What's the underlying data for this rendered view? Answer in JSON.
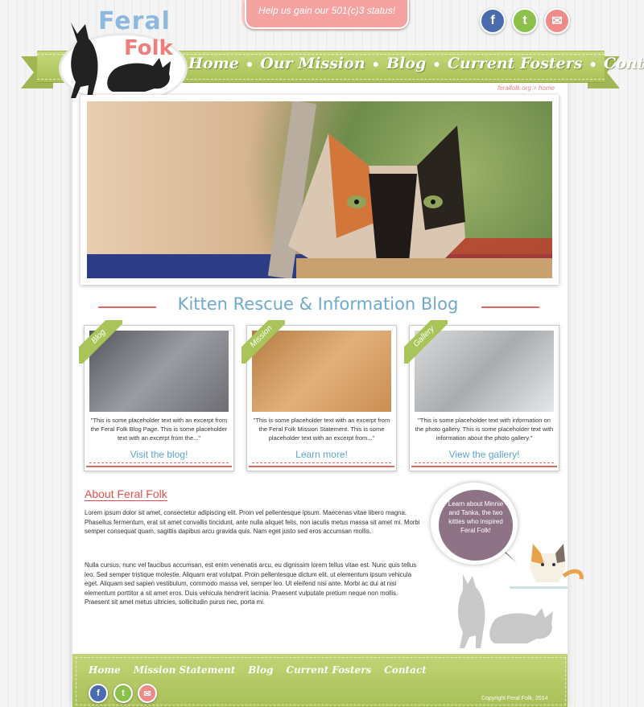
{
  "banner": {
    "text": "Help us gain our 501(c)3 status!"
  },
  "logo": {
    "word1": "Feral",
    "word2": "Folk"
  },
  "nav": {
    "items": [
      "Home",
      "Our Mission",
      "Blog",
      "Current Fosters",
      "Contact"
    ]
  },
  "social": {
    "facebook": "f",
    "twitter": "t",
    "mail": "✉"
  },
  "breadcrumb": "feralfolk.org > home",
  "section_title": "Kitten Rescue & Information Blog",
  "cards": [
    {
      "tag": "Blog",
      "text": "\"This is some placeholder text with an excerpt from the Feral Folk Blog Page. This is some placeholder text with an excerpt from the...\"",
      "link": "Visit the blog!",
      "color": "#7e7f86"
    },
    {
      "tag": "Mission",
      "text": "\"This is some placeholder text with an excerpt from the Feral Folk Mission Statement. This is some placeholder text with an excerpt from...\"",
      "link": "Learn more!",
      "color": "#d99a5e"
    },
    {
      "tag": "Gallery",
      "text": "\"This is some placeholder text with information on the photo gallery. This is some placeholder text with information about the photo gallery.\"",
      "link": "View the gallery!",
      "color": "#b9bdc1"
    }
  ],
  "about": {
    "heading": "About Feral Folk",
    "p1": "Lorem ipsum dolor sit amet, consectetur adipiscing elit. Proin vel pellentesque ipsum. Maecenas vitae libero magna. Phasellus fermentum, erat sit amet convallis tincidunt, ante nulla aliquet felis, non iaculis metus massa sit amet mi. Morbi semper consequat quam, sagittis dapibus arcu gravida quis. Nam eget justo sed eros accumsan mollis.",
    "p2": "Nulla cursus, nunc vel faucibus accumsan, est enim venenatis arcu, eu dignissim lorem tellus vitae est. Nunc quis tellus leo. Sed semper tristique molestie. Aliquam erat volutpat. Proin pellentesque dictum elit, ut elementum ipsum vehicula eget. Aliquam sed sapien vestibulum, commodo massa vel, semper leo. Ut eleifend nisi ante. Morbi ac dui at nisi elementum porttitor a sit amet eros. Duis vehicula hendrerit lacinia. Praesent vulputate pretium neque non mollis. Praesent sit amet metus ultricies, sollicitudin purus nec, porta mi."
  },
  "bubble": {
    "text": "Learn about Minnie and Tanka, the two kitties who inspired Feral Folk!"
  },
  "footer": {
    "nav": [
      "Home",
      "Mission Statement",
      "Blog",
      "Current Fosters",
      "Contact"
    ],
    "copyright": "Copyright Feral Folk, 2014"
  }
}
